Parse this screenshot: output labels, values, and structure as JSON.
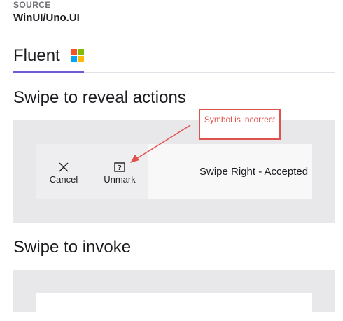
{
  "source": {
    "label": "SOURCE",
    "value": "WinUI/Uno.UI"
  },
  "tabs": [
    {
      "label": "Fluent",
      "icon": "microsoft-logo-icon",
      "selected": true
    }
  ],
  "colors": {
    "accent": "#6b5cd6",
    "annotation": "#e0524e",
    "panel": "#e8e8eb",
    "logo_red": "#f35325",
    "logo_green": "#81bc06",
    "logo_blue": "#05a6f0",
    "logo_yellow": "#ffba08"
  },
  "sections": {
    "reveal": {
      "heading": "Swipe to reveal actions",
      "actions": [
        {
          "label": "Cancel",
          "icon": "close-icon"
        },
        {
          "label": "Unmark",
          "icon": "help-box-icon"
        }
      ],
      "content_text": "Swipe Right - Accepted"
    },
    "invoke": {
      "heading": "Swipe to invoke"
    }
  },
  "annotation": {
    "text": "Symbol is incorrect"
  }
}
